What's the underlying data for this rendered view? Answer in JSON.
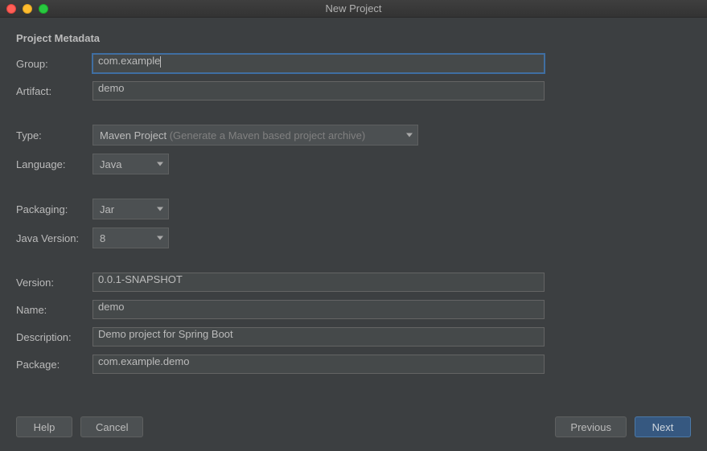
{
  "window": {
    "title": "New Project"
  },
  "section": {
    "header": "Project Metadata"
  },
  "labels": {
    "group": "Group:",
    "artifact": "Artifact:",
    "type": "Type:",
    "language": "Language:",
    "packaging": "Packaging:",
    "java_version": "Java Version:",
    "version": "Version:",
    "name": "Name:",
    "description": "Description:",
    "package": "Package:"
  },
  "fields": {
    "group": "com.example",
    "artifact": "demo",
    "type_value": "Maven Project",
    "type_hint": "(Generate a Maven based project archive)",
    "language": "Java",
    "packaging": "Jar",
    "java_version": "8",
    "version": "0.0.1-SNAPSHOT",
    "name": "demo",
    "description": "Demo project for Spring Boot",
    "package": "com.example.demo"
  },
  "buttons": {
    "help": "Help",
    "cancel": "Cancel",
    "previous": "Previous",
    "next": "Next"
  }
}
